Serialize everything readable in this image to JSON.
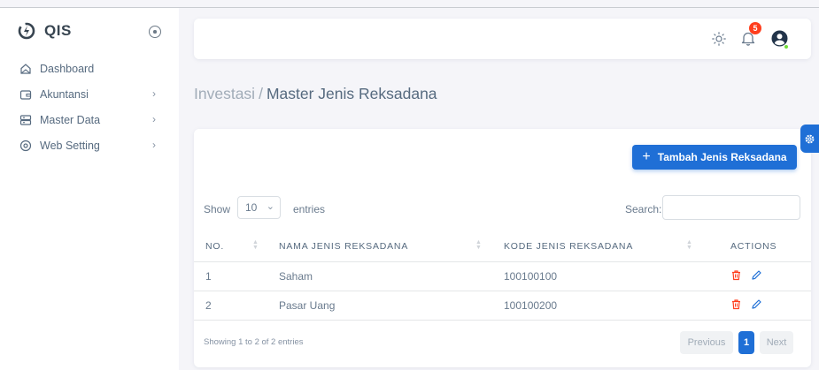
{
  "brand": {
    "name": "QIS"
  },
  "sidebar": {
    "items": [
      {
        "label": "Dashboard",
        "icon": "home-icon",
        "has_chevron": false
      },
      {
        "label": "Akuntansi",
        "icon": "wallet-icon",
        "has_chevron": true
      },
      {
        "label": "Master Data",
        "icon": "server-icon",
        "has_chevron": true
      },
      {
        "label": "Web Setting",
        "icon": "cog-icon",
        "has_chevron": true
      }
    ]
  },
  "navbar": {
    "notification_count": "5"
  },
  "breadcrumb": {
    "parent": "Investasi",
    "separator": "/",
    "current": "Master Jenis Reksadana"
  },
  "card": {
    "add_button_label": "Tambah Jenis Reksadana",
    "show_label": "Show",
    "entries_value": "10",
    "entries_label": "entries",
    "search_label": "Search:",
    "search_value": "",
    "table": {
      "headers": [
        "NO.",
        "NAMA JENIS REKSADANA",
        "KODE JENIS REKSADANA",
        "ACTIONS"
      ],
      "rows": [
        {
          "no": "1",
          "nama": "Saham",
          "kode": "100100100"
        },
        {
          "no": "2",
          "nama": "Pasar Uang",
          "kode": "100100200"
        }
      ]
    },
    "info_text": "Showing 1 to 2 of 2 entries",
    "pagination": {
      "previous": "Previous",
      "current_page": "1",
      "next": "Next"
    }
  },
  "colors": {
    "primary": "#1f6fd6",
    "danger": "#ff3e1d",
    "success": "#71dd37",
    "text": "#566a7f"
  }
}
